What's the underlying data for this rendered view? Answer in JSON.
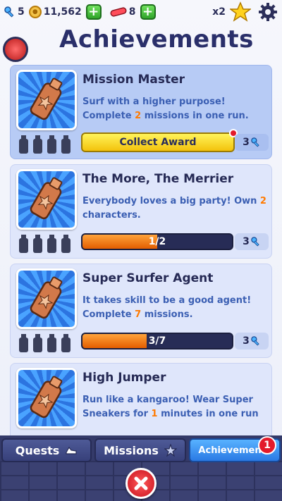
{
  "topbar": {
    "keys": "5",
    "coins": "11,562",
    "hoverboards": "8",
    "multiplier": "x2"
  },
  "page": {
    "title": "Achievements"
  },
  "achievements": [
    {
      "title": "Mission Master",
      "desc_before": "Surf with a higher purpose! Complete ",
      "desc_num": "2",
      "desc_after": " missions in one run.",
      "action_label": "Collect Award",
      "reward": "3",
      "progress": 1.0
    },
    {
      "title": "The More, The Merrier",
      "desc_before": "Everybody loves a big party! Own ",
      "desc_num": "2",
      "desc_after": " characters.",
      "progress_text": "1/2",
      "progress": 0.5,
      "reward": "3"
    },
    {
      "title": "Super Surfer Agent",
      "desc_before": "It takes skill to be a good agent! Complete ",
      "desc_num": "7",
      "desc_after": " missions.",
      "progress_text": "3/7",
      "progress": 0.4286,
      "reward": "3"
    },
    {
      "title": "High Jumper",
      "desc_before": "Run like a kangaroo! Wear Super Sneakers for ",
      "desc_num": "1",
      "desc_after": " minutes in one run"
    }
  ],
  "tabs": {
    "quests": "Quests",
    "missions": "Missions",
    "achievements": "Achievements",
    "achievements_badge": "1"
  },
  "colors": {
    "accent": "#2a79e4",
    "title": "#2a2f6a",
    "desc": "#3b5fb3",
    "highlight_number": "#ff7a00",
    "progress_fill": "#e35d00"
  }
}
